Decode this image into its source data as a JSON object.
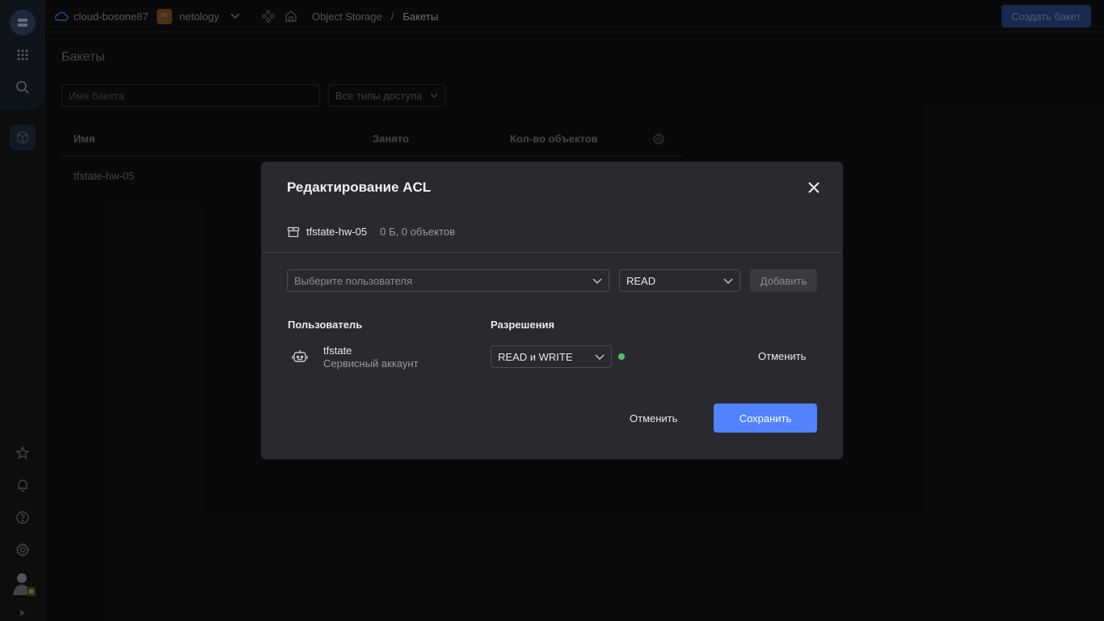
{
  "header": {
    "cloud_name": "cloud-bosone87",
    "org_badge": "NE",
    "org_name": "netology",
    "breadcrumb": [
      "Object Storage",
      "/",
      "Бакеты"
    ],
    "create_button": "Создать бакет"
  },
  "page": {
    "title": "Бакеты",
    "search_placeholder": "Имя бакета",
    "access_filter": "Все типы доступа",
    "columns": [
      "Имя",
      "Занято",
      "Кол-во объектов"
    ],
    "rows": [
      {
        "name": "tfstate-hw-05"
      }
    ]
  },
  "modal": {
    "title": "Редактирование ACL",
    "bucket_name": "tfstate-hw-05",
    "bucket_meta": "0 Б, 0 объектов",
    "user_select_placeholder": "Выберите пользователя",
    "permission_select": "READ",
    "add_button": "Добавить",
    "col_user": "Пользователь",
    "col_permissions": "Разрешения",
    "entries": [
      {
        "user": "tfstate",
        "type": "Сервисный аккаунт",
        "permission": "READ и WRITE",
        "status_color": "#4fc36a",
        "cancel": "Отменить"
      }
    ],
    "cancel_button": "Отменить",
    "save_button": "Сохранить"
  }
}
